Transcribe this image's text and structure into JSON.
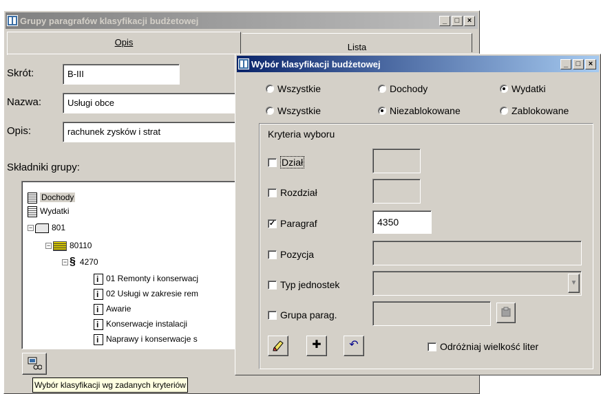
{
  "back_window": {
    "title": "Grupy paragrafów klasyfikacji budżetowej",
    "title_buttons": [
      "_",
      "□",
      "×"
    ],
    "tabs": [
      {
        "label": "Opis",
        "active": true
      },
      {
        "label": "Lista",
        "active": false
      }
    ],
    "fields": {
      "skrot": {
        "label": "Skrót:",
        "value": "B-III"
      },
      "nazwa": {
        "label": "Nazwa:",
        "value": "Usługi obce"
      },
      "opis": {
        "label": "Opis:",
        "value": "rachunek zysków i strat"
      }
    },
    "skladniki_label": "Składniki grupy:",
    "tree": [
      {
        "label": "Dochody",
        "icon": "book-icon",
        "selected": true
      },
      {
        "label": "Wydatki",
        "icon": "book-icon"
      },
      {
        "label": "801",
        "icon": "folder-icon"
      },
      {
        "label": "80110",
        "icon": "list-icon"
      },
      {
        "label": "4270",
        "icon": "paragraph-icon"
      },
      {
        "label": "01 Remonty i konserwacj",
        "icon": "item-icon"
      },
      {
        "label": "02 Usługi w zakresie rem",
        "icon": "item-icon"
      },
      {
        "label": "Awarie",
        "icon": "item-icon"
      },
      {
        "label": "Konserwacje instalacji",
        "icon": "item-icon"
      },
      {
        "label": "Naprawy i konserwacje s",
        "icon": "item-icon"
      }
    ],
    "tooltip": "Wybór klasyfikacji wg  zadanych kryteriów"
  },
  "front_window": {
    "title": "Wybór klasyfikacji budżetowej",
    "title_buttons": [
      "_",
      "□",
      "×"
    ],
    "radio_row1": [
      {
        "label": "Wszystkie",
        "checked": false
      },
      {
        "label": "Dochody",
        "checked": false
      },
      {
        "label": "Wydatki",
        "checked": true
      }
    ],
    "radio_row2": [
      {
        "label": "Wszystkie",
        "checked": false
      },
      {
        "label": "Niezablokowane",
        "checked": true
      },
      {
        "label": "Zablokowane",
        "checked": false
      }
    ],
    "criteria": {
      "title": "Kryteria wyboru",
      "dzial": {
        "label": "Dział",
        "checked": false,
        "value": ""
      },
      "rozdzial": {
        "label": "Rozdział",
        "checked": false,
        "value": ""
      },
      "paragraf": {
        "label": "Paragraf",
        "checked": true,
        "value": "4350"
      },
      "pozycja": {
        "label": "Pozycja",
        "checked": false,
        "value": ""
      },
      "typ_jednostek": {
        "label": "Typ jednostek",
        "checked": false,
        "value": ""
      },
      "grupa_parag": {
        "label": "Grupa parag.",
        "checked": false,
        "value": ""
      },
      "case_sensitive": {
        "label": "Odróżniaj wielkość liter",
        "checked": false
      },
      "check_mark": "✓"
    }
  },
  "colors": {
    "face": "#d4d0c8",
    "active_title": "#0a246a",
    "inactive_title": "#808080",
    "tooltip_bg": "#ffffe1"
  }
}
